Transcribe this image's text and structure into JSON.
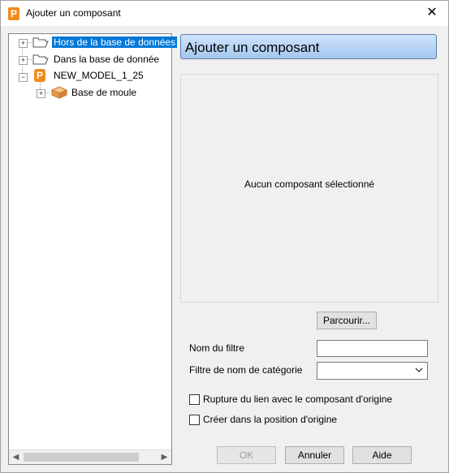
{
  "window": {
    "title": "Ajouter un composant",
    "icon": "P"
  },
  "tree": {
    "items": [
      {
        "label": "Hors de la base de données",
        "icon": "folder-open-icon"
      },
      {
        "label": "Dans la base de donnée",
        "icon": "folder-open-icon"
      },
      {
        "label": "NEW_MODEL_1_25",
        "icon": "model-p-icon"
      },
      {
        "label": "Base de moule",
        "icon": "mold-base-icon"
      }
    ]
  },
  "header": {
    "title": "Ajouter un composant"
  },
  "preview": {
    "empty_text": "Aucun composant sélectionné"
  },
  "browse_label": "Parcourir...",
  "filters": {
    "name_label": "Nom du filtre",
    "name_value": "",
    "category_label": "Filtre de nom de catégorie",
    "category_value": ""
  },
  "options": {
    "break_link_label": "Rupture du lien avec le composant d'origine",
    "break_link_checked": false,
    "origin_label": "Créer dans la position d'origine",
    "origin_checked": false
  },
  "buttons": {
    "ok": "OK",
    "cancel": "Annuler",
    "help": "Aide"
  },
  "colors": {
    "selection": "#0078d7",
    "accent": "#f28b1e"
  }
}
